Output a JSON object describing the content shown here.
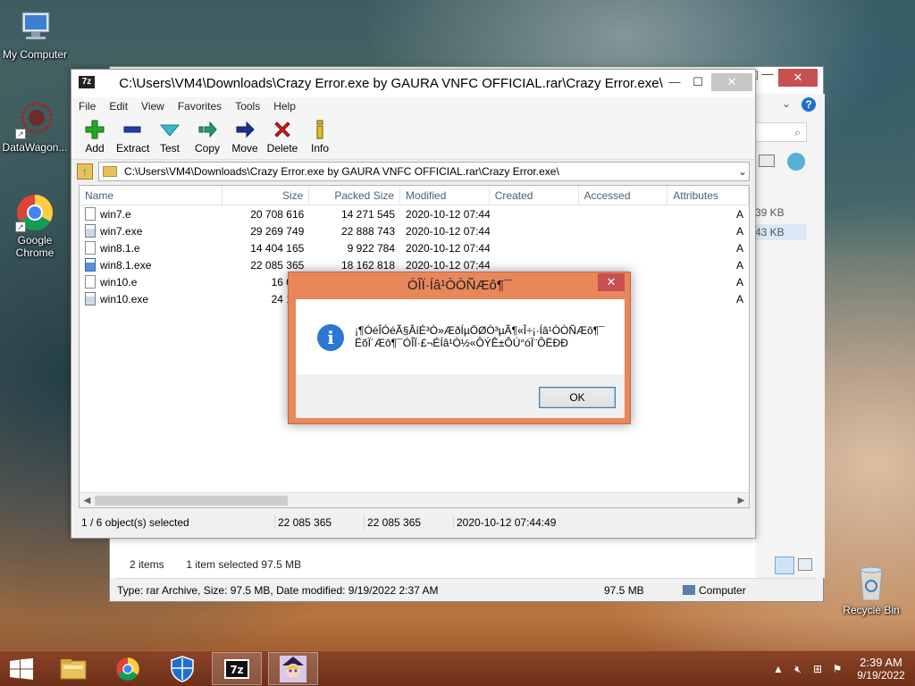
{
  "desktop": {
    "icons": [
      {
        "label": "My Computer"
      },
      {
        "label": "DataWagon..."
      },
      {
        "label": "Google Chrome"
      },
      {
        "label": "Recycle Bin"
      }
    ]
  },
  "explorer": {
    "minimize": "—",
    "maximize": "☐",
    "close": "✕",
    "sizes": [
      "39 KB",
      "43 KB"
    ],
    "status_items": "2 items",
    "status_selected": "1 item selected  97.5 MB",
    "details": "Type: rar Archive, Size: 97.5 MB, Date modified: 9/19/2022 2:37 AM",
    "details_size": "97.5 MB",
    "details_location": "Computer"
  },
  "zip": {
    "title": "C:\\Users\\VM4\\Downloads\\Crazy Error.exe by GAURA VNFC OFFICIAL.rar\\Crazy Error.exe\\",
    "icon_text": "7z",
    "minimize": "—",
    "maximize": "☐",
    "close": "✕",
    "menu": [
      "File",
      "Edit",
      "View",
      "Favorites",
      "Tools",
      "Help"
    ],
    "toolbar": [
      "Add",
      "Extract",
      "Test",
      "Copy",
      "Move",
      "Delete",
      "Info"
    ],
    "address": "C:\\Users\\VM4\\Downloads\\Crazy Error.exe by GAURA VNFC OFFICIAL.rar\\Crazy Error.exe\\",
    "columns": [
      "Name",
      "Size",
      "Packed Size",
      "Modified",
      "Created",
      "Accessed",
      "Attributes"
    ],
    "files": [
      {
        "name": "win7.e",
        "size": "20 708 616",
        "packed": "14 271 545",
        "modified": "2020-10-12 07:44",
        "attr": "A",
        "type": "file"
      },
      {
        "name": "win7.exe",
        "size": "29 269 749",
        "packed": "22 888 743",
        "modified": "2020-10-12 07:44",
        "attr": "A",
        "type": "exe"
      },
      {
        "name": "win8.1.e",
        "size": "14 404 165",
        "packed": "9 922 784",
        "modified": "2020-10-12 07:44",
        "attr": "A",
        "type": "file"
      },
      {
        "name": "win8.1.exe",
        "size": "22 085 365",
        "packed": "18 162 818",
        "modified": "2020-10-12 07:44",
        "attr": "A",
        "type": "exe-sel"
      },
      {
        "name": "win10.e",
        "size": "16 054",
        "packed": "",
        "modified": "",
        "attr": "A",
        "type": "file"
      },
      {
        "name": "win10.exe",
        "size": "24 133",
        "packed": "",
        "modified": "",
        "attr": "A",
        "type": "exe"
      }
    ],
    "status": [
      "1 / 6 object(s) selected",
      "22 085 365",
      "22 085 365",
      "2020-10-12 07:44:49"
    ]
  },
  "dialog": {
    "title": "ÓÎÏ·Íâ¹ÒÒÑÆô¶¯",
    "message": "¡¶ÓéÎÓéÃ§ÂíÉ³Ò»ÆðÍµÖØÒ³µÃ¶«Î÷¡·Íâ¹ÒÒÑÆô¶¯ ËõÏ´Æô¶¯ÓÎÏ·£¬ÉÍâ¹Ò½«ÔÝÊ±ÔÚ°óÏ¨ÔËÐÐ",
    "ok_label": "OK",
    "close": "✕"
  },
  "taskbar": {
    "time": "2:39 AM",
    "date": "9/19/2022",
    "apps": [
      "file-explorer",
      "chrome",
      "security",
      "7zip",
      "game"
    ],
    "accent": "#8a4327"
  }
}
